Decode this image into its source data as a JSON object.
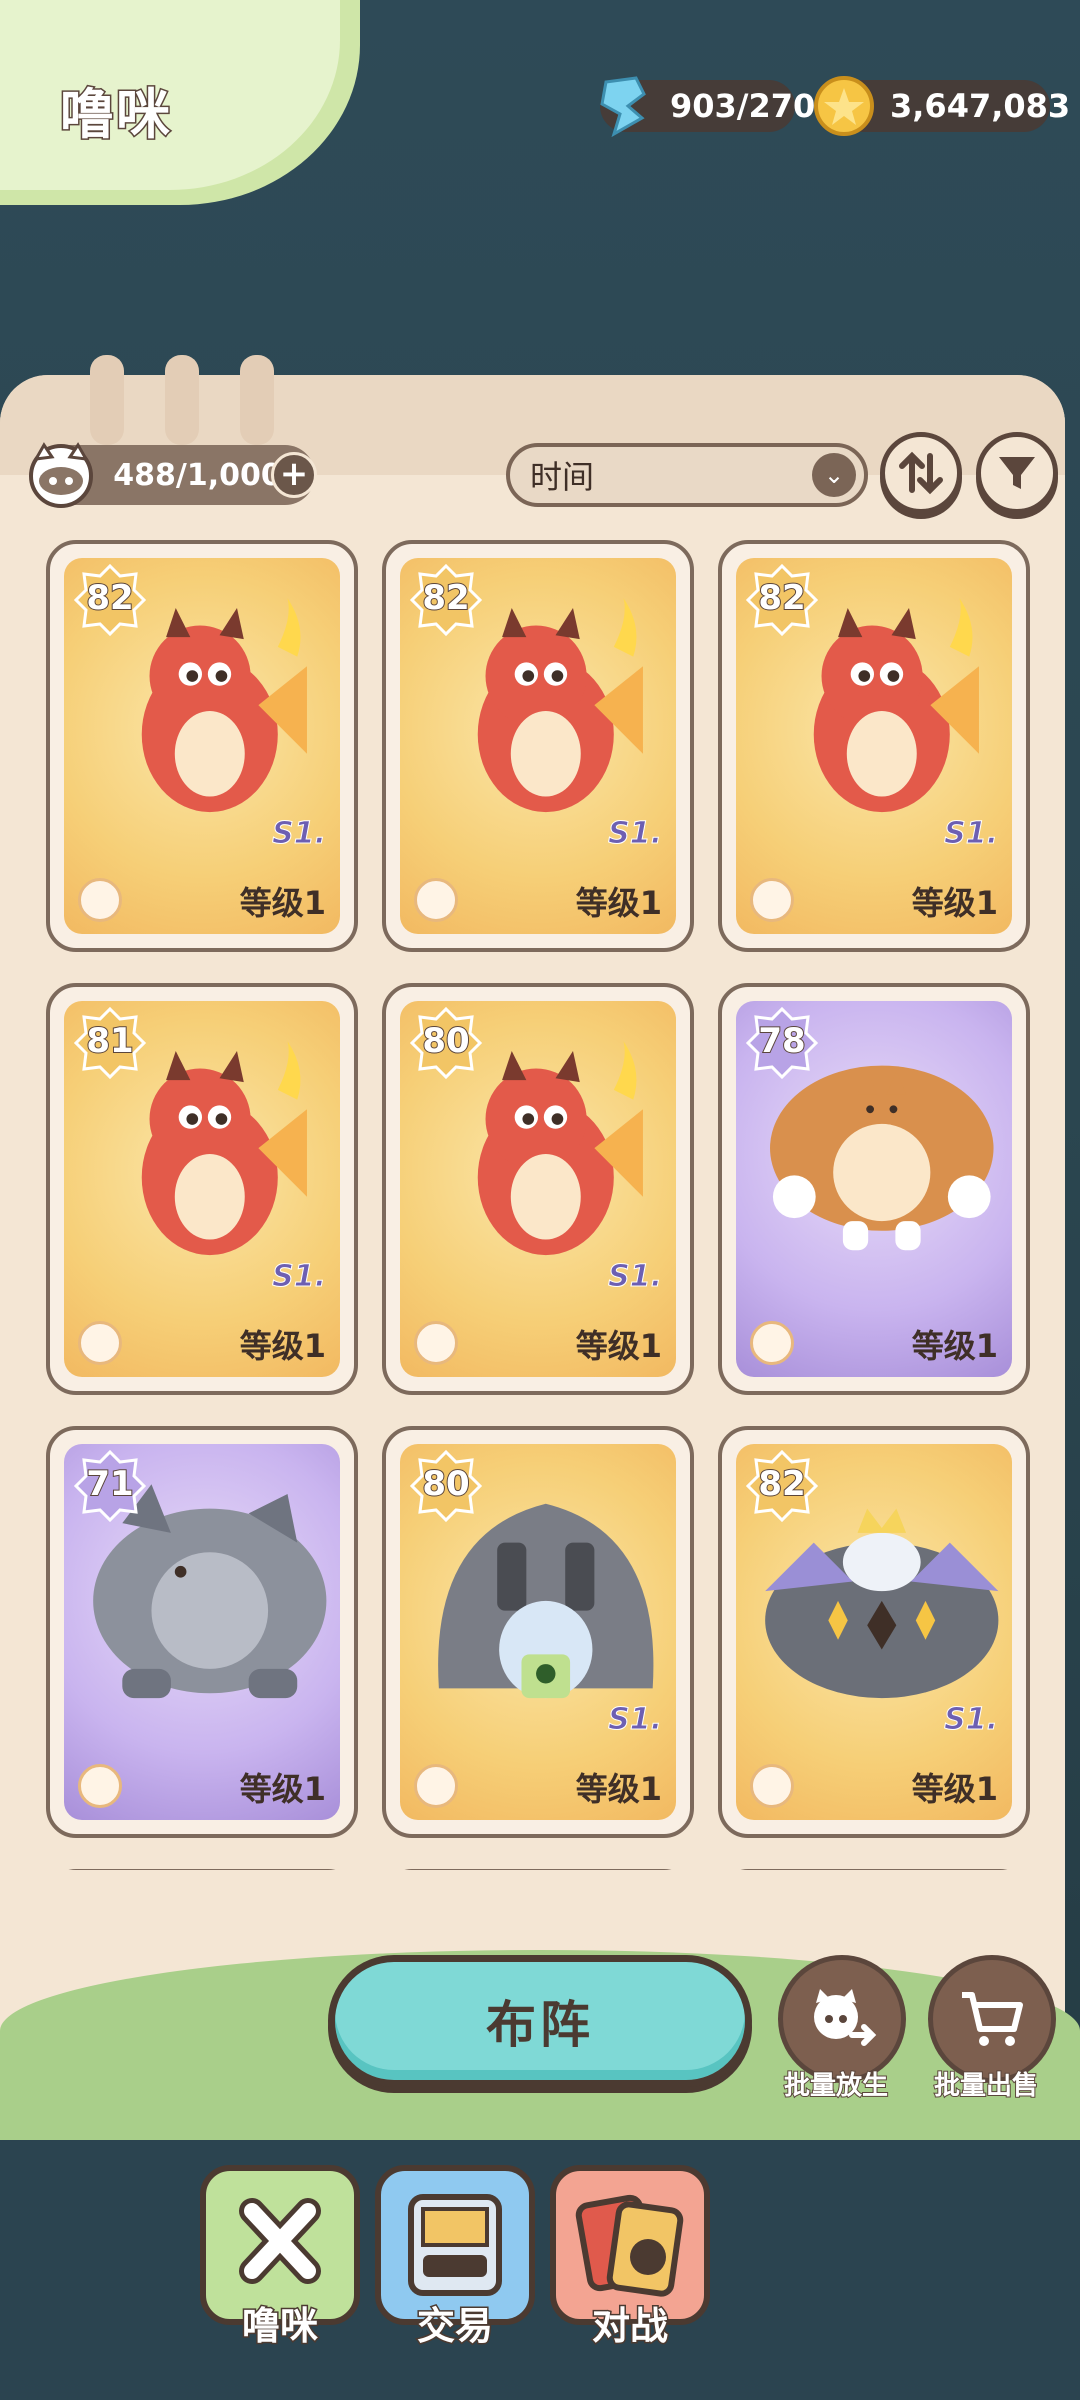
{
  "header": {
    "title": "噜咪",
    "energy": "903/270",
    "coins": "3,647,083"
  },
  "toolbar": {
    "capacity": "488/1,000",
    "sort_value": "时间"
  },
  "cards": [
    {
      "power": "82",
      "level": "等级1",
      "season": "S1.",
      "bg": "gold",
      "creature": "red-dragon"
    },
    {
      "power": "82",
      "level": "等级1",
      "season": "S1.",
      "bg": "gold",
      "creature": "red-dragon"
    },
    {
      "power": "82",
      "level": "等级1",
      "season": "S1.",
      "bg": "gold",
      "creature": "red-dragon"
    },
    {
      "power": "81",
      "level": "等级1",
      "season": "S1.",
      "bg": "gold",
      "creature": "red-dragon"
    },
    {
      "power": "80",
      "level": "等级1",
      "season": "S1.",
      "bg": "gold",
      "creature": "red-dragon"
    },
    {
      "power": "78",
      "level": "等级1",
      "season": "",
      "bg": "purple",
      "creature": "muscle-dog"
    },
    {
      "power": "71",
      "level": "等级1",
      "season": "",
      "bg": "purple",
      "creature": "rock-rhino"
    },
    {
      "power": "80",
      "level": "等级1",
      "season": "S1.",
      "bg": "gold",
      "creature": "helmet-bunny"
    },
    {
      "power": "82",
      "level": "等级1",
      "season": "S1.",
      "bg": "gold",
      "creature": "crown-knight"
    }
  ],
  "actions": {
    "deploy": "布阵",
    "batch_release": "批量放生",
    "batch_sell": "批量出售"
  },
  "nav": {
    "tab1": "噜咪",
    "tab2": "交易",
    "tab3": "对战"
  },
  "colors": {
    "accent_teal": "#7fd9d6",
    "panel": "#f4e6d4",
    "brown": "#5b463c"
  }
}
